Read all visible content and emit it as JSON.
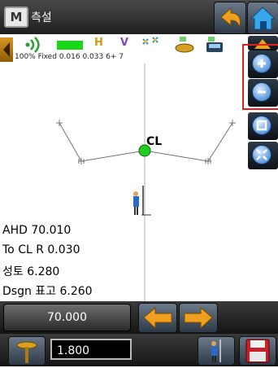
{
  "window": {
    "logo_letter": "M",
    "title": "측설"
  },
  "status": {
    "battery": "100%",
    "fix": "Fixed",
    "h_precision": "0.016",
    "v_precision": "0.033",
    "satellites": "6+ 7",
    "h_label": "H",
    "v_label": "V"
  },
  "map": {
    "centerline_label": "CL"
  },
  "info": {
    "ahd": "AHD 70.010",
    "to_cl": "To CL R 0.030",
    "fill": "성토 6.280",
    "design": "Dsgn 표고 6.260"
  },
  "bottom": {
    "value_display": "70.000",
    "rod_height": "1.800"
  },
  "colors": {
    "titlebar": "#2e2e2e",
    "signal": "#18d618",
    "orange_arrow": "#f0a020",
    "point": "#22cc22",
    "highlight_box": "#e12020"
  }
}
